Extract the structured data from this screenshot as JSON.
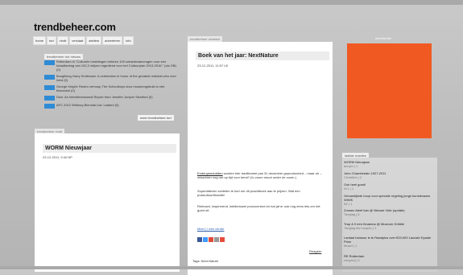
{
  "site": {
    "logo": "trendbeheer.com"
  },
  "nav": [
    "home",
    "tort",
    "vindt",
    "verslaat",
    "ateliers",
    "adverteren",
    "info"
  ],
  "news": {
    "tag": "trendbeheer tort nieuws",
    "items": [
      "Rotterdam in \"Culturele instellingen hebben 109 subsidieaanvragen voor een totaalbedrag van 102,2 miljoen ingediend voor het Cultuurplan 2013-2016.\" (via OB) (0)",
      "Bongillong Harry Smitenaar: A celebration in honor of the greatest redwhat who ever lived (0)",
      "George Knight: Reden verhoop The Schoolboys door museumgebuik is niet financieel (0)",
      "Dice: An Interdimensional Report from Jennifer Juniper Stratford (0)",
      "AFC 2012 Whitney Biennial List: Leaked (0)"
    ],
    "more": "meer trendbeheer tort"
  },
  "worm": {
    "tag": "trendbeheer vindt",
    "title": "WORM Nieuwjaar",
    "date": "23-12-2011, 9:40 NP"
  },
  "boek": {
    "tag": "trendbeheer verslaat",
    "title": "Boek van het jaar: NextNature",
    "date": "23-12-2011, 11:57 LB",
    "p1_link": "Endeupendudden",
    "p1_rest": " worden hier traditioneel pas 31 december geproduceerd – maar uh – misschien nog net op tijd voor kerst? (In zoom mood onder de zoom.)",
    "p2": "Superlatieven schieten te kort om dit prachtboek aan te prijzen. Wat een postcultuurfilosofie!",
    "p3": "Relevant, inspirerend, intellectueel provocerend en hat jaf er ook nog eens iets om het goed uit.",
    "more": "Meer | Lees verder",
    "reageer": "Reageer",
    "tags": "Tags: Next-Nature"
  },
  "share_colors": [
    "#3b5998",
    "#4099ff",
    "#dd4b39",
    "#999999",
    "#e74c3c"
  ],
  "sidebar": {
    "ad_label": "advertentie",
    "ad_color": "#f05a22",
    "latest_tag": "laatste reacties",
    "latest": [
      {
        "title": "WORM Nieuwjaar",
        "meta": "aenyin | 1"
      },
      {
        "title": "John Chamberlain 1927-2011",
        "meta": "Christlieb | 2"
      },
      {
        "title": "Ook heel goed!",
        "meta": "W.L | 1"
      },
      {
        "title": "Gevaarlijkste hoop voor speciale regeling jonge kunstenaars WWIK",
        "meta": "B2 | 1"
      },
      {
        "title": "Zonsen Aleef kan @ Nieuwe Vide (update)",
        "meta": "Toeglag | 8"
      },
      {
        "title": "Trap & 0 een Ihnaema @ Museum Gribble",
        "meta": "Toeglag dis hoopdu | 1"
      },
      {
        "title": "Lantaai Iamsour is te Raadplus over €20,000 Lacoste Eyaale Prize",
        "meta": "Muset | 1"
      },
      {
        "title": "RE Rotterdam",
        "meta": "vergrouj | 1"
      }
    ]
  }
}
